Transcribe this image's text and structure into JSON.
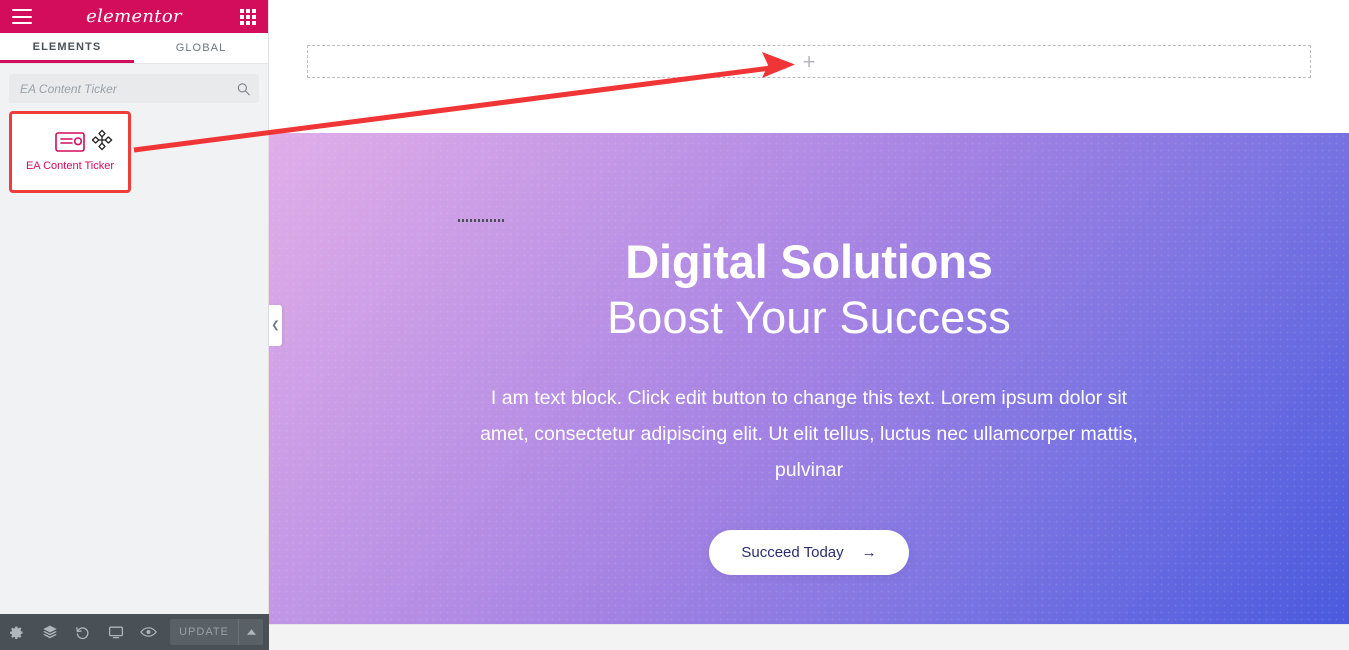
{
  "panel": {
    "header": {
      "menu_icon": "hamburger-icon",
      "logo_text": "elementor",
      "grid_icon": "apps-grid-icon"
    },
    "tabs": [
      {
        "label": "ELEMENTS",
        "active": true
      },
      {
        "label": "GLOBAL",
        "active": false
      }
    ],
    "search": {
      "value": "",
      "placeholder": "EA Content Ticker",
      "icon": "search-icon"
    },
    "widgets": [
      {
        "label": "EA Content Ticker",
        "icon": "content-ticker-icon",
        "selected": true,
        "cursor_icon": "move-arrows-icon"
      }
    ],
    "footer": {
      "icons": [
        "settings-gear-icon",
        "navigator-layers-icon",
        "history-undo-icon",
        "responsive-monitor-icon",
        "preview-eye-icon"
      ],
      "update_label": "UPDATE",
      "update_disabled": true,
      "caret_icon": "chevron-up-icon"
    },
    "collapse_handle_icon": "chevron-left-icon"
  },
  "canvas": {
    "dropzone": {
      "add_icon": "plus-icon",
      "label": ""
    },
    "hero": {
      "title_line1": "Digital Solutions",
      "title_line2": "Boost Your Success",
      "body": "I am text block. Click edit button to change this text. Lorem ipsum dolor sit amet, consectetur adipiscing elit. Ut elit tellus, luctus nec ullamcorper mattis, pulvinar",
      "button_label": "Succeed Today",
      "button_arrow": "→",
      "gradient_start": "#e0aee8",
      "gradient_end": "#4a5ade"
    }
  },
  "annotation": {
    "arrow_color": "#ef3535",
    "from": "EA Content Ticker widget card",
    "to": "add-section plus in drop zone"
  },
  "colors": {
    "brand_pink": "#d30c5c",
    "highlight_red": "#ef3d3d",
    "footer_bg": "#495157"
  }
}
